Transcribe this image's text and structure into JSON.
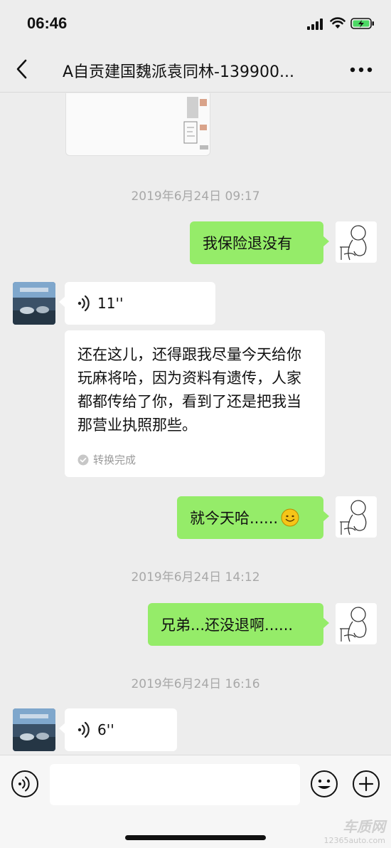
{
  "status_bar": {
    "time": "06:46"
  },
  "header": {
    "title": "A自贡建国魏派袁同林-139900..."
  },
  "messages": {
    "ts1": "2019年6月24日 09:17",
    "m1": "我保险退没有",
    "voice1": "11''",
    "transcript": "还在这儿，还得跟我尽量今天给你玩麻将哈，因为资料有遗传，人家都都传给了你，看到了还是把我当那营业执照那些。",
    "transcript_status": "转换完成",
    "m2": "就今天哈......",
    "ts2": "2019年6月24日 14:12",
    "m3": "兄弟...还没退啊......",
    "ts3": "2019年6月24日 16:16",
    "voice2": "6''"
  },
  "watermark": {
    "brand": "车质网",
    "url": "12365auto.com"
  },
  "colors": {
    "bubble_outgoing": "#95ec69",
    "background": "#ededed",
    "timestamp": "#a8a8a8"
  }
}
